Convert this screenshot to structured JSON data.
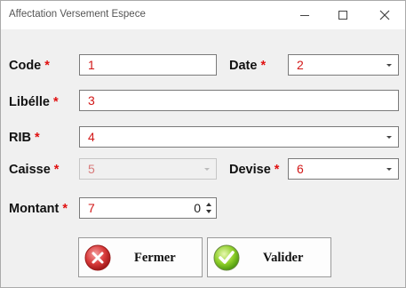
{
  "window": {
    "title": "Affectation Versement Espece"
  },
  "form": {
    "code": {
      "label": "Code",
      "required": "*",
      "value": "1"
    },
    "date": {
      "label": "Date",
      "required": "*",
      "value": "2"
    },
    "libelle": {
      "label": "Libélle",
      "required": "*",
      "value": "3"
    },
    "rib": {
      "label": "RIB",
      "required": "*",
      "value": "4"
    },
    "caisse": {
      "label": "Caisse",
      "required": "*",
      "value": "5"
    },
    "devise": {
      "label": "Devise",
      "required": "*",
      "value": "6"
    },
    "montant": {
      "label": "Montant",
      "required": "*",
      "value": "7",
      "number": "0"
    }
  },
  "buttons": {
    "fermer": "Fermer",
    "valider": "Valider"
  }
}
